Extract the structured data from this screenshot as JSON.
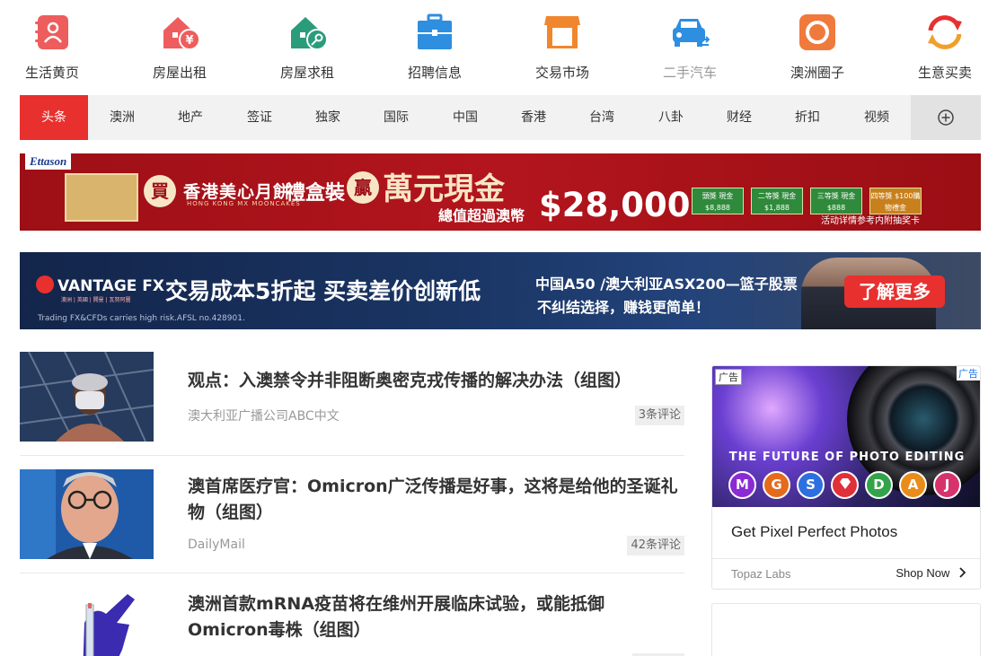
{
  "top_icons": [
    {
      "label": "生活黄页",
      "icon": "address-book-icon",
      "color": "#ee5d5d"
    },
    {
      "label": "房屋出租",
      "icon": "house-rent-icon",
      "color": "#ee5d5d"
    },
    {
      "label": "房屋求租",
      "icon": "house-key-icon",
      "color": "#2a9c7a"
    },
    {
      "label": "招聘信息",
      "icon": "briefcase-icon",
      "color": "#2e8ee0"
    },
    {
      "label": "交易市场",
      "icon": "storefront-icon",
      "color": "#f0862d"
    },
    {
      "label": "二手汽车",
      "icon": "car-icon",
      "color": "#2e8ee0"
    },
    {
      "label": "澳洲圈子",
      "icon": "circle-icon",
      "color": "#f07a3c"
    },
    {
      "label": "生意买卖",
      "icon": "exchange-arrows-icon",
      "color": "#f07a3c"
    }
  ],
  "nav": {
    "tabs": [
      "头条",
      "澳洲",
      "地产",
      "签证",
      "独家",
      "国际",
      "中国",
      "香港",
      "台湾",
      "八卦",
      "财经",
      "折扣",
      "视频"
    ],
    "active": "头条",
    "more_icon": "plus-circle-icon",
    "accent": "#e8302f"
  },
  "banner_mooncake": {
    "brand": "Ettason",
    "buy": "買",
    "product": "香港美心月餅",
    "product_en": "HONG KONG MX MOONCAKES",
    "package": "禮盒裝",
    "win": "贏",
    "prize_title": "萬元現金",
    "prize_sub": "總值超過澳幣",
    "amount": "$28,000",
    "prizes": [
      "頭獎 現金$8,888",
      "二等獎 現金$1,888",
      "三等獎 現金$888",
      "四等獎 $100購物禮金"
    ],
    "note": "活动详情参考内附抽奖卡"
  },
  "banner_vantage": {
    "logo": "VANTAGE FX",
    "logo_sub": "澳洲 | 英國 | 開曼 | 瓦努阿圖",
    "headline": "交易成本5折起  买卖差价创新低",
    "line1": "中国A50 /澳大利亚ASX200—篮子股票",
    "line2": "不纠结选择，赚钱更简单！",
    "disclaimer": "Trading FX&CFDs carries high risk.AFSL no.428901.",
    "cta": "了解更多"
  },
  "articles": [
    {
      "title": "观点：入澳禁令并非阻断奥密克戎传播的解决办法（组图）",
      "source": "澳大利亚广播公司ABC中文",
      "comments": "3条评论"
    },
    {
      "title": "澳首席医疗官：Omicron广泛传播是好事，这将是给他的圣诞礼物（组图）",
      "source": "DailyMail",
      "comments": "42条评论"
    },
    {
      "title": "澳洲首款mRNA疫苗将在维州开展临床试验，或能抵御Omicron毒株（组图）",
      "source": "",
      "comments": ""
    }
  ],
  "ad": {
    "tag": "广告",
    "tag_right": "广告",
    "image_text": "THE FUTURE OF PHOTO EDITING",
    "badges": [
      {
        "letter": "M",
        "color": "#8a2bd6"
      },
      {
        "letter": "G",
        "color": "#e46a1c"
      },
      {
        "letter": "S",
        "color": "#2e6fe0"
      },
      {
        "letter": "",
        "color": "#e0303a"
      },
      {
        "letter": "D",
        "color": "#33a34a"
      },
      {
        "letter": "A",
        "color": "#e98c1a"
      },
      {
        "letter": "J",
        "color": "#d6336c"
      }
    ],
    "headline": "Get Pixel Perfect Photos",
    "advertiser": "Topaz Labs",
    "cta": "Shop Now"
  }
}
